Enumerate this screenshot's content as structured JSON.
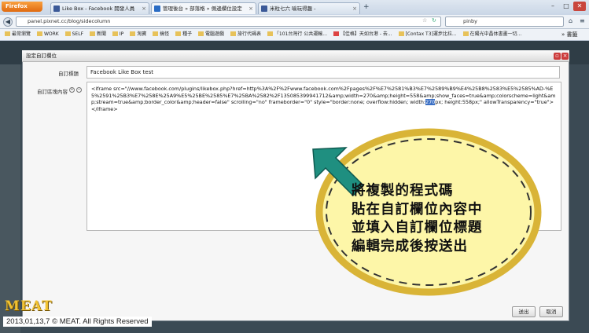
{
  "browser": {
    "app_button": "Firefox",
    "tabs": [
      {
        "label": "Like Box - Facebook 開發人員",
        "favicon_color": "#3b5998"
      },
      {
        "label": "管理後台 » 部落格 » 側邊欄位設定",
        "favicon_color": "#2a6cc4"
      },
      {
        "label": "米粒七六 喻玩得趣 -",
        "favicon_color": "#3b5998"
      }
    ],
    "new_tab": "+",
    "url": "panel.pixnet.cc/blog/sidecolumn",
    "search_value": "pinby",
    "bookmarks": [
      "最常瀏覽",
      "WORK",
      "SELF",
      "新聞",
      "IP",
      "淘寶",
      "搞怪",
      "種子",
      "電腦遊戲",
      "旅行代碼表",
      "「101台灣行 公共運輸...",
      "【佳格】天如台港 - 去...",
      "[Contax T3]運步比拉...",
      "在陽光中晶体書畫一切..."
    ],
    "bookmarks_more": "»",
    "bookmarks_end": "書籤"
  },
  "dialog": {
    "title": "設定自訂欄位",
    "field_title_label": "自訂標題",
    "field_title_value": "Facebook Like Box test",
    "field_content_label": "自訂區塊內容",
    "code_before": "<iframe src=\"//www.facebook.com/plugins/likebox.php?href=http%3A%2F%2Fwww.facebook.com%2Fpages%2F%E7%2581%B3%E7%2589%B9%E4%25B8%2583%E5%2585%AD-%E5%2591%25B3%E7%258E%25A9%E5%25BE%2585%E7%25BA%2582%2F135085399941712&amp;width=270&amp;height=558&amp;show_faces=true&amp;colorscheme=light&amp;stream=true&amp;border_color&amp;header=false\" scrolling=\"no\" frameborder=\"0\" style=\"border:none; overflow:hidden; width:",
    "code_selected": "270",
    "code_after": "px; height:558px;\" allowTransparency=\"true\"></iframe>",
    "send_button": "送出",
    "cancel_button": "取消"
  },
  "annotation": {
    "lines": [
      "將複製的程式碼",
      "貼在自訂欄位內容中",
      "並填入自訂欄位標題",
      "編輯完成後按送出"
    ],
    "bubble_fill": "#fdf6a8",
    "bubble_stroke": "#d9b437",
    "arrow_color": "#1f8f80"
  },
  "watermark": {
    "logo": "MEAT",
    "copyright": "2013,01,13,7 © MEAT. All Rights Reserved"
  }
}
